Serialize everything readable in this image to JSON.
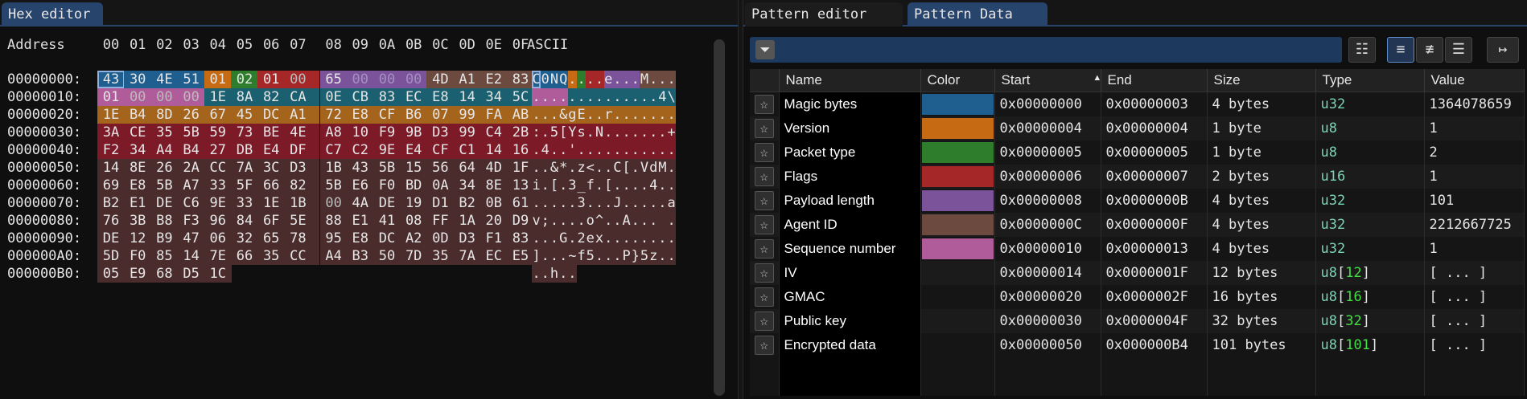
{
  "hex_editor": {
    "tab_label": "Hex editor",
    "header": {
      "address": "Address",
      "columns": [
        "00",
        "01",
        "02",
        "03",
        "04",
        "05",
        "06",
        "07",
        "08",
        "09",
        "0A",
        "0B",
        "0C",
        "0D",
        "0E",
        "0F"
      ],
      "ascii": "ASCII"
    },
    "rows": [
      {
        "addr": "00000000:",
        "bytes": [
          "43",
          "30",
          "4E",
          "51",
          "01",
          "02",
          "01",
          "00",
          "65",
          "00",
          "00",
          "00",
          "4D",
          "A1",
          "E2",
          "83"
        ],
        "ascii": [
          "C",
          "0",
          "N",
          "Q",
          ".",
          ".",
          ".",
          ".",
          "e",
          ".",
          ".",
          ".",
          "M",
          ".",
          ".",
          "."
        ]
      },
      {
        "addr": "00000010:",
        "bytes": [
          "01",
          "00",
          "00",
          "00",
          "1E",
          "8A",
          "82",
          "CA",
          "0E",
          "CB",
          "83",
          "EC",
          "E8",
          "14",
          "34",
          "5C"
        ],
        "ascii": [
          ".",
          ".",
          ".",
          ".",
          ".",
          ".",
          ".",
          ".",
          ".",
          ".",
          ".",
          ".",
          ".",
          ".",
          "4",
          "\\"
        ]
      },
      {
        "addr": "00000020:",
        "bytes": [
          "1E",
          "B4",
          "8D",
          "26",
          "67",
          "45",
          "DC",
          "A1",
          "72",
          "E8",
          "CF",
          "B6",
          "07",
          "99",
          "FA",
          "AB"
        ],
        "ascii": [
          ".",
          ".",
          ".",
          "&",
          "g",
          "E",
          ".",
          ".",
          "r",
          ".",
          ".",
          ".",
          ".",
          ".",
          ".",
          "."
        ]
      },
      {
        "addr": "00000030:",
        "bytes": [
          "3A",
          "CE",
          "35",
          "5B",
          "59",
          "73",
          "BE",
          "4E",
          "A8",
          "10",
          "F9",
          "9B",
          "D3",
          "99",
          "C4",
          "2B"
        ],
        "ascii": [
          ":",
          ".",
          "5",
          "[",
          "Y",
          "s",
          ".",
          "N",
          ".",
          ".",
          ".",
          ".",
          ".",
          ".",
          ".",
          "+"
        ]
      },
      {
        "addr": "00000040:",
        "bytes": [
          "F2",
          "34",
          "A4",
          "B4",
          "27",
          "DB",
          "E4",
          "DF",
          "C7",
          "C2",
          "9E",
          "E4",
          "CF",
          "C1",
          "14",
          "16"
        ],
        "ascii": [
          ".",
          "4",
          ".",
          ".",
          "'",
          ".",
          ".",
          ".",
          ".",
          ".",
          ".",
          ".",
          ".",
          ".",
          ".",
          "."
        ]
      },
      {
        "addr": "00000050:",
        "bytes": [
          "14",
          "8E",
          "26",
          "2A",
          "CC",
          "7A",
          "3C",
          "D3",
          "1B",
          "43",
          "5B",
          "15",
          "56",
          "64",
          "4D",
          "1F"
        ],
        "ascii": [
          ".",
          ".",
          "&",
          "*",
          ".",
          "z",
          "<",
          ".",
          ".",
          "C",
          "[",
          ".",
          "V",
          "d",
          "M",
          "."
        ]
      },
      {
        "addr": "00000060:",
        "bytes": [
          "69",
          "E8",
          "5B",
          "A7",
          "33",
          "5F",
          "66",
          "82",
          "5B",
          "E6",
          "F0",
          "BD",
          "0A",
          "34",
          "8E",
          "13"
        ],
        "ascii": [
          "i",
          ".",
          "[",
          ".",
          "3",
          "_",
          "f",
          ".",
          "[",
          ".",
          ".",
          ".",
          ".",
          "4",
          ".",
          "."
        ]
      },
      {
        "addr": "00000070:",
        "bytes": [
          "B2",
          "E1",
          "DE",
          "C6",
          "9E",
          "33",
          "1E",
          "1B",
          "00",
          "4A",
          "DE",
          "19",
          "D1",
          "B2",
          "0B",
          "61"
        ],
        "ascii": [
          ".",
          ".",
          ".",
          ".",
          ".",
          "3",
          ".",
          ".",
          ".",
          "J",
          ".",
          ".",
          ".",
          ".",
          ".",
          "a"
        ]
      },
      {
        "addr": "00000080:",
        "bytes": [
          "76",
          "3B",
          "B8",
          "F3",
          "96",
          "84",
          "6F",
          "5E",
          "88",
          "E1",
          "41",
          "08",
          "FF",
          "1A",
          "20",
          "D9"
        ],
        "ascii": [
          "v",
          ";",
          ".",
          ".",
          ".",
          ".",
          "o",
          "^",
          ".",
          ".",
          "A",
          ".",
          ".",
          ".",
          " ",
          "."
        ]
      },
      {
        "addr": "00000090:",
        "bytes": [
          "DE",
          "12",
          "B9",
          "47",
          "06",
          "32",
          "65",
          "78",
          "95",
          "E8",
          "DC",
          "A2",
          "0D",
          "D3",
          "F1",
          "83"
        ],
        "ascii": [
          ".",
          ".",
          ".",
          "G",
          ".",
          "2",
          "e",
          "x",
          ".",
          ".",
          ".",
          ".",
          ".",
          ".",
          ".",
          "."
        ]
      },
      {
        "addr": "000000A0:",
        "bytes": [
          "5D",
          "F0",
          "85",
          "14",
          "7E",
          "66",
          "35",
          "CC",
          "A4",
          "B3",
          "50",
          "7D",
          "35",
          "7A",
          "EC",
          "E5"
        ],
        "ascii": [
          "]",
          ".",
          ".",
          ".",
          "~",
          "f",
          "5",
          ".",
          ".",
          ".",
          "P",
          "}",
          "5",
          "z",
          ".",
          "."
        ]
      },
      {
        "addr": "000000B0:",
        "bytes": [
          "05",
          "E9",
          "68",
          "D5",
          "1C"
        ],
        "ascii": [
          ".",
          ".",
          "h",
          ".",
          "."
        ]
      }
    ]
  },
  "pattern_editor": {
    "tab_label": "Pattern editor"
  },
  "pattern_data": {
    "tab_label": "Pattern Data",
    "filter_placeholder": "",
    "columns": {
      "name": "Name",
      "color": "Color",
      "start": "Start",
      "end": "End",
      "size": "Size",
      "type": "Type",
      "value": "Value"
    },
    "rows": [
      {
        "name": "Magic bytes",
        "color": "#1f5f8f",
        "start": "0x00000000",
        "end": "0x00000003",
        "size": "4 bytes",
        "type_base": "u32",
        "type_count": "",
        "value": "1364078659"
      },
      {
        "name": "Version",
        "color": "#c66b14",
        "start": "0x00000004",
        "end": "0x00000004",
        "size": "1 byte",
        "type_base": "u8",
        "type_count": "",
        "value": "1"
      },
      {
        "name": "Packet type",
        "color": "#2d7d2d",
        "start": "0x00000005",
        "end": "0x00000005",
        "size": "1 byte",
        "type_base": "u8",
        "type_count": "",
        "value": "2"
      },
      {
        "name": "Flags",
        "color": "#a52727",
        "start": "0x00000006",
        "end": "0x00000007",
        "size": "2 bytes",
        "type_base": "u16",
        "type_count": "",
        "value": "1"
      },
      {
        "name": "Payload length",
        "color": "#7b539b",
        "start": "0x00000008",
        "end": "0x0000000B",
        "size": "4 bytes",
        "type_base": "u32",
        "type_count": "",
        "value": "101"
      },
      {
        "name": "Agent ID",
        "color": "#6d4a40",
        "start": "0x0000000C",
        "end": "0x0000000F",
        "size": "4 bytes",
        "type_base": "u32",
        "type_count": "",
        "value": "2212667725"
      },
      {
        "name": "Sequence number",
        "color": "#b15c9a",
        "start": "0x00000010",
        "end": "0x00000013",
        "size": "4 bytes",
        "type_base": "u32",
        "type_count": "",
        "value": "1"
      },
      {
        "name": "IV",
        "color": "",
        "start": "0x00000014",
        "end": "0x0000001F",
        "size": "12 bytes",
        "type_base": "u8",
        "type_count": "12",
        "value": "[ ... ]"
      },
      {
        "name": "GMAC",
        "color": "",
        "start": "0x00000020",
        "end": "0x0000002F",
        "size": "16 bytes",
        "type_base": "u8",
        "type_count": "16",
        "value": "[ ... ]"
      },
      {
        "name": "Public key",
        "color": "",
        "start": "0x00000030",
        "end": "0x0000004F",
        "size": "32 bytes",
        "type_base": "u8",
        "type_count": "32",
        "value": "[ ... ]"
      },
      {
        "name": "Encrypted data",
        "color": "",
        "start": "0x00000050",
        "end": "0x000000B4",
        "size": "101 bytes",
        "type_base": "u8",
        "type_count": "101",
        "value": "[ ... ]"
      }
    ]
  },
  "icons": {
    "filter": "filter-icon",
    "star": "star-icon",
    "book": "book-icon",
    "tree_expanded": "tree-expanded-icon",
    "tree_flat": "tree-flat-icon",
    "list": "list-icon",
    "jump": "jump-icon"
  },
  "colors": {
    "accent": "#27446c",
    "filter_bar": "#1d3a5e",
    "highlight_magic": "#1f5f8f",
    "highlight_version": "#c66b14",
    "highlight_packet_type": "#2d7d2d",
    "highlight_flags": "#a52727",
    "highlight_payload_length": "#7b539b",
    "highlight_agent_id": "#6d4a40",
    "highlight_sequence": "#b15c9a",
    "highlight_iv": "#1a6070",
    "highlight_gmac": "#a4641b",
    "highlight_public_key": "#7c1a28",
    "highlight_encrypted": "#4b2c2c"
  }
}
